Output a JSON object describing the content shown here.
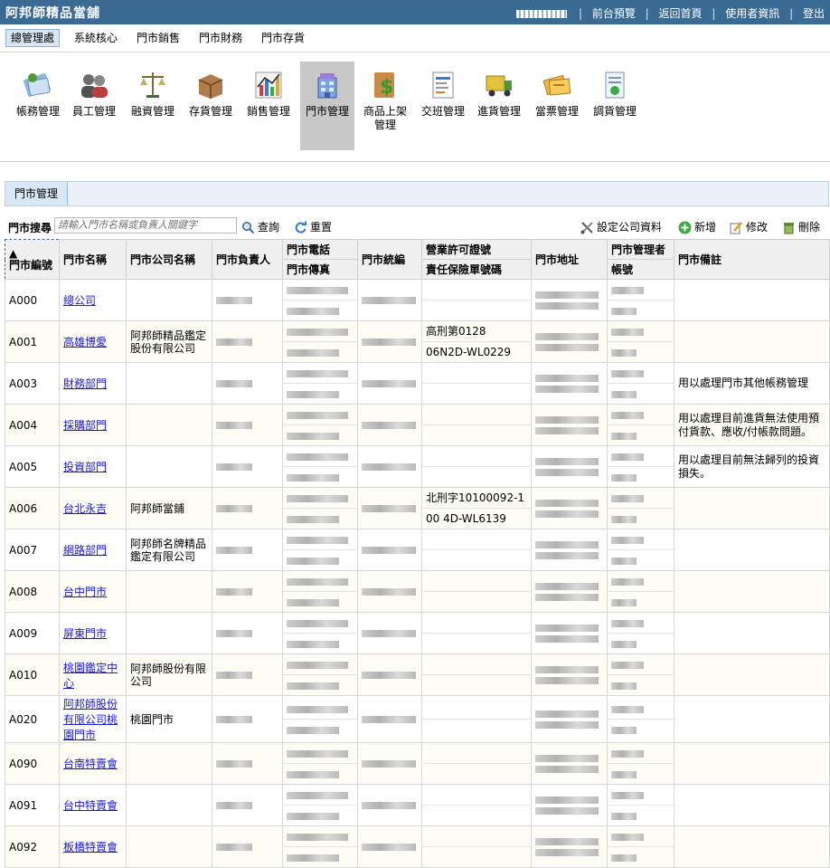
{
  "header": {
    "brand": "阿邦師精品當舖",
    "links": [
      "前台預覽",
      "返回首頁",
      "使用者資訊",
      "登出"
    ]
  },
  "menu": {
    "items": [
      "總管理處",
      "系統核心",
      "門市銷售",
      "門市財務",
      "門市存貨"
    ],
    "active_index": 0
  },
  "modules": [
    {
      "label": "帳務管理",
      "icon": "ledger-icon"
    },
    {
      "label": "員工管理",
      "icon": "staff-icon"
    },
    {
      "label": "融資管理",
      "icon": "scale-icon"
    },
    {
      "label": "存貨管理",
      "icon": "inventory-box-icon"
    },
    {
      "label": "銷售管理",
      "icon": "sales-chart-icon"
    },
    {
      "label": "門市管理",
      "icon": "store-building-icon"
    },
    {
      "label": "商品上架\n管理",
      "icon": "product-money-icon"
    },
    {
      "label": "交班管理",
      "icon": "shift-doc-icon"
    },
    {
      "label": "進貨管理",
      "icon": "purchase-truck-icon"
    },
    {
      "label": "當票管理",
      "icon": "pawn-ticket-icon"
    },
    {
      "label": "調貨管理",
      "icon": "transfer-doc-icon"
    }
  ],
  "active_module": 5,
  "tab": {
    "label": "門市管理"
  },
  "search": {
    "label": "門市搜尋",
    "placeholder": "請輸入門市名稱或負責人關鍵字",
    "query_label": "查詢",
    "reset_label": "重置"
  },
  "actions": {
    "company_label": "設定公司資料",
    "add_label": "新增",
    "edit_label": "修改",
    "delete_label": "刪除"
  },
  "table": {
    "headers": {
      "code": "門市編號",
      "sort_indicator": "▲",
      "name": "門市名稱",
      "company": "門市公司名稱",
      "owner": "門市負責人",
      "phone": "門市電話",
      "fax": "門市傳真",
      "tax_id": "門市統編",
      "license": "營業許可證號",
      "insurance": "責任保險單號碼",
      "address": "門市地址",
      "manager": "門市管理者",
      "account": "帳號",
      "note": "門市備註"
    },
    "rows": [
      {
        "code": "A000",
        "name": "總公司",
        "company": "",
        "license": "",
        "insurance": "",
        "note": ""
      },
      {
        "code": "A001",
        "name": "高雄博愛",
        "company": "阿邦師精品鑑定股份有限公司",
        "license": "高刑第0128",
        "insurance": "06N2D-WL0229",
        "note": ""
      },
      {
        "code": "A003",
        "name": "財務部門",
        "company": "",
        "license": "",
        "insurance": "",
        "note": "用以處理門市其他帳務管理"
      },
      {
        "code": "A004",
        "name": "採購部門",
        "company": "",
        "license": "",
        "insurance": "",
        "note": "用以處理目前進貨無法使用預付貨款、應收/付帳款問題。"
      },
      {
        "code": "A005",
        "name": "投資部門",
        "company": "",
        "license": "",
        "insurance": "",
        "note": "用以處理目前無法歸列的投資損失。"
      },
      {
        "code": "A006",
        "name": "台北永吉",
        "company": "阿邦師當鋪",
        "license": "北刑字10100092-1",
        "insurance": "00 4D-WL6139",
        "note": ""
      },
      {
        "code": "A007",
        "name": "網路部門",
        "company": "阿邦師名牌精品鑑定有限公司",
        "license": "",
        "insurance": "",
        "note": ""
      },
      {
        "code": "A008",
        "name": "台中門市",
        "company": "",
        "license": "",
        "insurance": "",
        "note": ""
      },
      {
        "code": "A009",
        "name": "屏東門市",
        "company": "",
        "license": "",
        "insurance": "",
        "note": ""
      },
      {
        "code": "A010",
        "name": "桃園鑑定中心",
        "company": "阿邦師股份有限公司",
        "license": "",
        "insurance": "",
        "note": ""
      },
      {
        "code": "A020",
        "name": "阿邦師股份有限公司桃園門市",
        "company": "桃園門市",
        "license": "",
        "insurance": "",
        "note": ""
      },
      {
        "code": "A090",
        "name": "台南特賣會",
        "company": "",
        "license": "",
        "insurance": "",
        "note": ""
      },
      {
        "code": "A091",
        "name": "台中特賣會",
        "company": "",
        "license": "",
        "insurance": "",
        "note": ""
      },
      {
        "code": "A092",
        "name": "板橋特賣會",
        "company": "",
        "license": "",
        "insurance": "",
        "note": ""
      }
    ]
  }
}
